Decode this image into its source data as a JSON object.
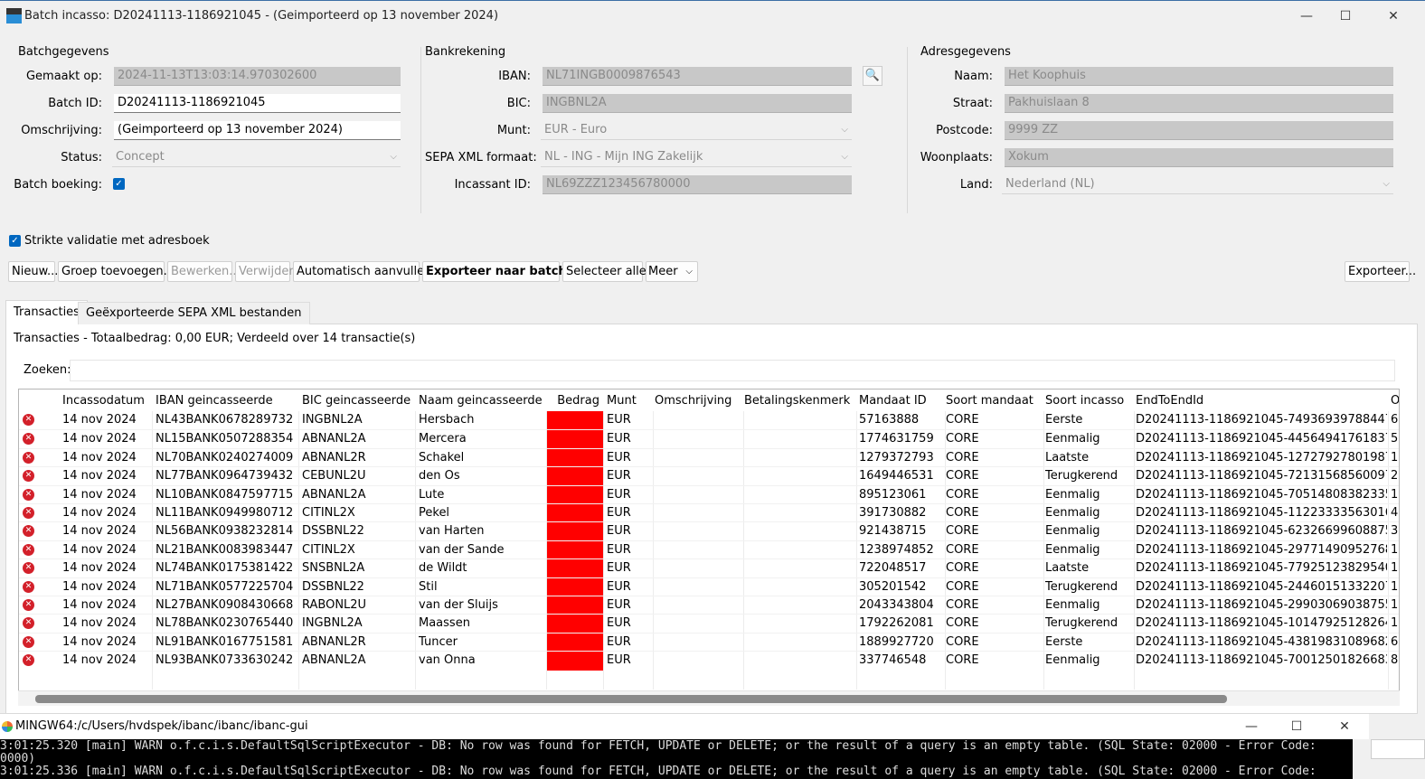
{
  "window": {
    "title": "Batch incasso: D20241113-1186921045 - (Geimporteerd op 13 november 2024)",
    "minimize": "—",
    "maximize": "☐",
    "close": "✕"
  },
  "batch": {
    "section": "Batchgegevens",
    "created_label": "Gemaakt op:",
    "created_value": "2024-11-13T13:03:14.970302600",
    "id_label": "Batch ID:",
    "id_value": "D20241113-1186921045",
    "desc_label": "Omschrijving:",
    "desc_value": "(Geimporteerd op 13 november 2024)",
    "status_label": "Status:",
    "status_value": "Concept",
    "booking_label": "Batch boeking:",
    "booking_checked": true
  },
  "bank": {
    "section": "Bankrekening",
    "iban_label": "IBAN:",
    "iban_value": "NL71INGB0009876543",
    "bic_label": "BIC:",
    "bic_value": "INGBNL2A",
    "currency_label": "Munt:",
    "currency_value": "EUR - Euro",
    "sepa_label": "SEPA XML formaat:",
    "sepa_value": "NL - ING - Mijn ING Zakelijk",
    "creditor_label": "Incassant ID:",
    "creditor_value": "NL69ZZZ123456780000"
  },
  "address": {
    "section": "Adresgegevens",
    "name_label": "Naam:",
    "name_value": "Het Koophuis",
    "street_label": "Straat:",
    "street_value": "Pakhuislaan 8",
    "zip_label": "Postcode:",
    "zip_value": "9999 ZZ",
    "city_label": "Woonplaats:",
    "city_value": "Xokum",
    "country_label": "Land:",
    "country_value": "Nederland (NL)"
  },
  "strict_validation_label": "Strikte validatie met adresboek",
  "toolbar": {
    "new": "Nieuw...",
    "add_group": "Groep toevoegen...",
    "edit": "Bewerken...",
    "delete": "Verwijder",
    "autofill": "Automatisch aanvullen",
    "export_batch": "Exporteer naar batch...",
    "select_all": "Selecteer alles",
    "more": "Meer",
    "export": "Exporteer..."
  },
  "tabs": {
    "transactions": "Transacties",
    "exported": "Geëxporteerde SEPA XML bestanden"
  },
  "summary": "Transacties - Totaalbedrag: 0,00 EUR; Verdeeld over 14 transactie(s)",
  "search_label": "Zoeken:",
  "search_value": "",
  "table": {
    "headers": [
      "Incassodatum",
      "IBAN geincasseerde",
      "BIC geincasseerde",
      "Naam geincasseerde",
      "Bedrag",
      "Munt",
      "Omschrijving",
      "Betalingskenmerk",
      "Mandaat ID",
      "Soort mandaat",
      "Soort incasso",
      "EndToEndId",
      "O"
    ],
    "error_color": "#ff0000",
    "rows": [
      {
        "date": "14 nov 2024",
        "iban": "NL43BANK0678289732",
        "bic": "INGBNL2A",
        "name": "Hersbach",
        "currency": "EUR",
        "desc": "",
        "ref": "",
        "mandate": "57163888",
        "mtype": "CORE",
        "itype": "Eerste",
        "e2e": "D20241113-1186921045-74936939788447",
        "extra": "6"
      },
      {
        "date": "14 nov 2024",
        "iban": "NL15BANK0507288354",
        "bic": "ABNANL2A",
        "name": "Mercera",
        "currency": "EUR",
        "desc": "",
        "ref": "",
        "mandate": "1774631759",
        "mtype": "CORE",
        "itype": "Eenmalig",
        "e2e": "D20241113-1186921045-44564941761837",
        "extra": "5"
      },
      {
        "date": "14 nov 2024",
        "iban": "NL70BANK0240274009",
        "bic": "ABNANL2R",
        "name": "Schakel",
        "currency": "EUR",
        "desc": "",
        "ref": "",
        "mandate": "1279372793",
        "mtype": "CORE",
        "itype": "Laatste",
        "e2e": "D20241113-1186921045-12727927801987",
        "extra": "1"
      },
      {
        "date": "14 nov 2024",
        "iban": "NL77BANK0964739432",
        "bic": "CEBUNL2U",
        "name": "den Os",
        "currency": "EUR",
        "desc": "",
        "ref": "",
        "mandate": "1649446531",
        "mtype": "CORE",
        "itype": "Terugkerend",
        "e2e": "D20241113-1186921045-72131568560097",
        "extra": "2"
      },
      {
        "date": "14 nov 2024",
        "iban": "NL10BANK0847597715",
        "bic": "ABNANL2A",
        "name": "Lute",
        "currency": "EUR",
        "desc": "",
        "ref": "",
        "mandate": "895123061",
        "mtype": "CORE",
        "itype": "Eenmalig",
        "e2e": "D20241113-1186921045-70514808382335",
        "extra": "1"
      },
      {
        "date": "14 nov 2024",
        "iban": "NL11BANK0949980712",
        "bic": "CITINL2X",
        "name": "Pekel",
        "currency": "EUR",
        "desc": "",
        "ref": "",
        "mandate": "391730882",
        "mtype": "CORE",
        "itype": "Eenmalig",
        "e2e": "D20241113-1186921045-11223333563016",
        "extra": "4"
      },
      {
        "date": "14 nov 2024",
        "iban": "NL56BANK0938232814",
        "bic": "DSSBNL22",
        "name": "van Harten",
        "currency": "EUR",
        "desc": "",
        "ref": "",
        "mandate": "921438715",
        "mtype": "CORE",
        "itype": "Eenmalig",
        "e2e": "D20241113-1186921045-62326699608875",
        "extra": "3"
      },
      {
        "date": "14 nov 2024",
        "iban": "NL21BANK0083983447",
        "bic": "CITINL2X",
        "name": "van der Sande",
        "currency": "EUR",
        "desc": "",
        "ref": "",
        "mandate": "1238974852",
        "mtype": "CORE",
        "itype": "Eenmalig",
        "e2e": "D20241113-1186921045-29771490952768",
        "extra": "1"
      },
      {
        "date": "14 nov 2024",
        "iban": "NL74BANK0175381422",
        "bic": "SNSBNL2A",
        "name": "de Wildt",
        "currency": "EUR",
        "desc": "",
        "ref": "",
        "mandate": "722048517",
        "mtype": "CORE",
        "itype": "Laatste",
        "e2e": "D20241113-1186921045-77925123829540",
        "extra": "1"
      },
      {
        "date": "14 nov 2024",
        "iban": "NL71BANK0577225704",
        "bic": "DSSBNL22",
        "name": "Stil",
        "currency": "EUR",
        "desc": "",
        "ref": "",
        "mandate": "305201542",
        "mtype": "CORE",
        "itype": "Terugkerend",
        "e2e": "D20241113-1186921045-24460151332207",
        "extra": "1"
      },
      {
        "date": "14 nov 2024",
        "iban": "NL27BANK0908430668",
        "bic": "RABONL2U",
        "name": "van der Sluijs",
        "currency": "EUR",
        "desc": "",
        "ref": "",
        "mandate": "2043343804",
        "mtype": "CORE",
        "itype": "Eenmalig",
        "e2e": "D20241113-1186921045-29903069038755",
        "extra": "1"
      },
      {
        "date": "14 nov 2024",
        "iban": "NL78BANK0230765440",
        "bic": "INGBNL2A",
        "name": "Maassen",
        "currency": "EUR",
        "desc": "",
        "ref": "",
        "mandate": "1792262081",
        "mtype": "CORE",
        "itype": "Terugkerend",
        "e2e": "D20241113-1186921045-10147925128264",
        "extra": "1"
      },
      {
        "date": "14 nov 2024",
        "iban": "NL91BANK0167751581",
        "bic": "ABNANL2R",
        "name": "Tuncer",
        "currency": "EUR",
        "desc": "",
        "ref": "",
        "mandate": "1889927720",
        "mtype": "CORE",
        "itype": "Eerste",
        "e2e": "D20241113-1186921045-43819831089682",
        "extra": "6"
      },
      {
        "date": "14 nov 2024",
        "iban": "NL93BANK0733630242",
        "bic": "ABNANL2A",
        "name": "van Onna",
        "currency": "EUR",
        "desc": "",
        "ref": "",
        "mandate": "337746548",
        "mtype": "CORE",
        "itype": "Eenmalig",
        "e2e": "D20241113-1186921045-70012501826683",
        "extra": "8"
      }
    ]
  },
  "terminal": {
    "title": "MINGW64:/c/Users/hvdspek/ibanc/ibanc/ibanc-gui",
    "line1": "3:01:25.320 [main] WARN  o.f.c.i.s.DefaultSqlScriptExecutor - DB: No row was found for FETCH, UPDATE or DELETE; or the result of a query is an empty table. (SQL State: 02000 - Error Code:",
    "line2": "0000)",
    "line3": "3:01:25.336 [main] WARN  o.f.c.i.s.DefaultSqlScriptExecutor - DB: No row was found for FETCH, UPDATE or DELETE; or the result of a query is an empty table. (SQL State: 02000 - Error Code:"
  }
}
